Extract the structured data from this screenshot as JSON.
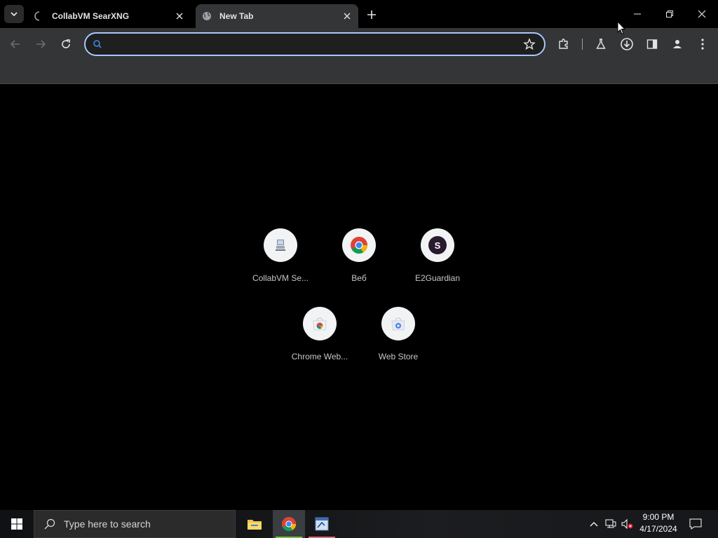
{
  "tabs": [
    {
      "title": "CollabVM SearXNG",
      "active": false,
      "loading": true
    },
    {
      "title": "New Tab",
      "active": true,
      "favicon": "globe-icon"
    }
  ],
  "omnibox": {
    "value": "",
    "placeholder": ""
  },
  "shortcuts": [
    {
      "label": "CollabVM Se...",
      "icon": "computer-icon"
    },
    {
      "label": "Веб",
      "icon": "chrome-icon"
    },
    {
      "label": "E2Guardian",
      "icon": "letter-s-icon",
      "letter": "S"
    },
    {
      "label": "Chrome Web...",
      "icon": "chrome-webstore-icon"
    },
    {
      "label": "Web Store",
      "icon": "webstore-icon"
    }
  ],
  "taskbar": {
    "search_placeholder": "Type here to search",
    "time": "9:00 PM",
    "date": "4/17/2024"
  },
  "colors": {
    "accent": "#a8c7fa",
    "chrome_indicator": "#7ac143",
    "app_indicator": "#e06c75"
  }
}
